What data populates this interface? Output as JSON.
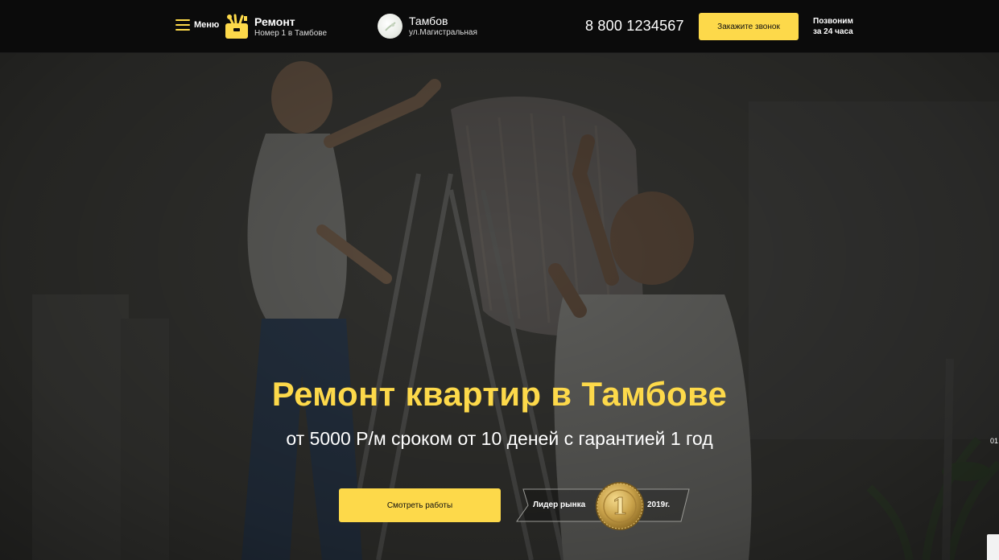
{
  "header": {
    "menu_label": "Меню",
    "logo_title": "Ремонт",
    "logo_subtitle": "Номер 1 в Тамбове",
    "city_name": "Тамбов",
    "city_address": "ул.Магистральная",
    "phone": "8 800 1234567",
    "call_button": "Закажите звонок",
    "callback_line1": "Позвоним",
    "callback_line2": "за 24 часа"
  },
  "hero": {
    "title": "Ремонт квартир в Тамбове",
    "subtitle": "от 5000 Р/м сроком от 10 деней с гарантией 1 год",
    "works_button": "Смотреть работы",
    "leader_label": "Лидер рынка",
    "medal_number": "1",
    "leader_year": "2019г.",
    "side_number": "01"
  },
  "colors": {
    "accent": "#fdd94a",
    "header_bg": "#0b0b0b",
    "text": "#ffffff"
  },
  "icons": [
    "menu-icon",
    "logo-toolbox-icon",
    "city-emblem-icon",
    "gold-medal-icon"
  ]
}
